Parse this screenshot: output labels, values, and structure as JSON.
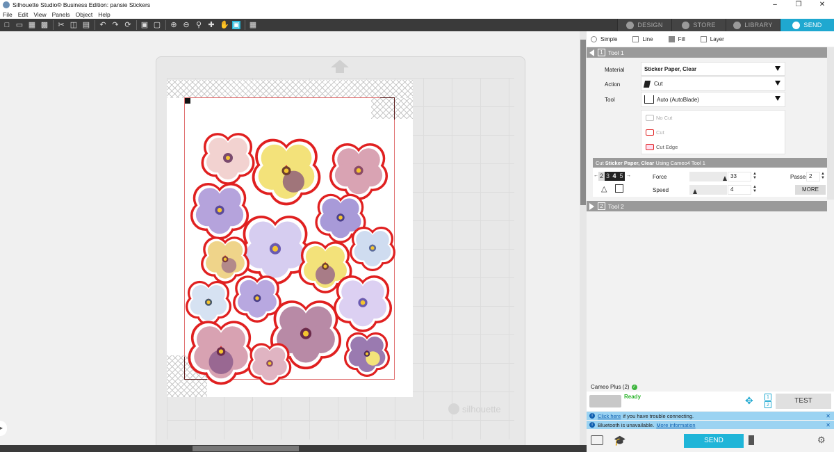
{
  "window": {
    "title": "Silhouette Studio® Business Edition: pansie Stickers",
    "minimize": "–",
    "maximize": "❐",
    "close": "✕"
  },
  "menu": [
    "File",
    "Edit",
    "View",
    "Panels",
    "Object",
    "Help"
  ],
  "toolbar_icons": [
    "new-file-icon",
    "open-folder-icon",
    "save-icon",
    "print-icon",
    "cut-icon",
    "copy-icon",
    "paste-icon",
    "undo-icon",
    "redo-icon",
    "redraw-icon",
    "select-all-icon",
    "deselect-icon",
    "zoom-in-icon",
    "zoom-out-icon",
    "zoom-box-icon",
    "pan-down-icon",
    "hand-icon",
    "fit-to-page-icon",
    "grid-icon"
  ],
  "nav": {
    "design": "DESIGN",
    "store": "STORE",
    "library": "LIBRARY",
    "send": "SEND",
    "active": "SEND"
  },
  "canvas": {
    "watermark": "silhouette"
  },
  "panel": {
    "modes": {
      "simple": "Simple",
      "line": "Line",
      "fill": "Fill",
      "layer": "Layer"
    },
    "tool1": {
      "number": "1",
      "label": "Tool 1"
    },
    "material_label": "Material",
    "material_value": "Sticker Paper, Clear",
    "action_label": "Action",
    "action_value": "Cut",
    "tool_label": "Tool",
    "tool_value": "Auto (AutoBlade)",
    "cut_options": {
      "no_cut": "No Cut",
      "cut": "Cut",
      "cut_edge": "Cut Edge"
    },
    "info": {
      "prefix": "Cut",
      "material": "Sticker Paper, Clear",
      "suffix": "Using Cameo4 Tool 1"
    },
    "blade_depth": [
      "2",
      "3",
      "4",
      "5"
    ],
    "force_label": "Force",
    "force_value": "33",
    "passes_label": "Passes",
    "passes_value": "2",
    "speed_label": "Speed",
    "speed_value": "4",
    "more_label": "MORE",
    "tool2": {
      "number": "2",
      "label": "Tool 2"
    }
  },
  "device": {
    "name": "Cameo Plus (2)",
    "status": "Ready",
    "tool_slots": [
      "1",
      "2"
    ],
    "test_label": "TEST"
  },
  "info_messages": {
    "msg1_link": "Click here",
    "msg1_text": "if you have trouble connecting.",
    "msg2_text": "Bluetooth is unavailable.",
    "msg2_link": "More information"
  },
  "bottom": {
    "send_label": "SEND"
  },
  "colors": {
    "accent": "#1fb5d8",
    "toolbar_bg": "#3a3a3a",
    "cut_line": "#e02020",
    "ready": "#2db52d"
  }
}
